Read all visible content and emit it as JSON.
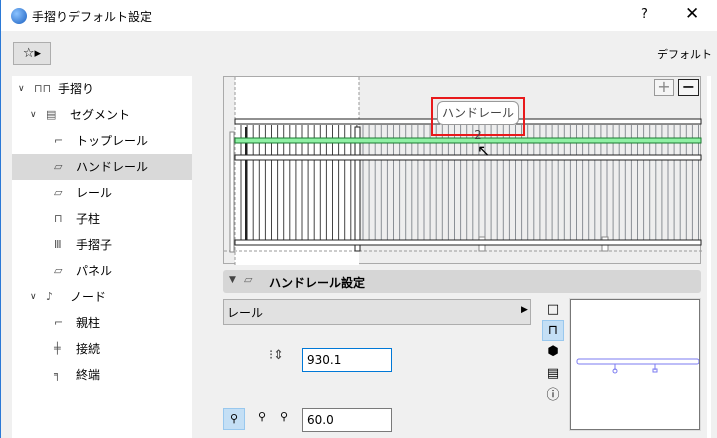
{
  "window": {
    "title": "手摺りデフォルト設定",
    "help": "?",
    "close": "✕"
  },
  "toolbar": {
    "favorites_icon": "☆▸",
    "default_label": "デフォルト"
  },
  "tree": [
    {
      "label": "手摺り",
      "level": 0,
      "expanded": true,
      "icon": "railing-icon"
    },
    {
      "label": "セグメント",
      "level": 1,
      "expanded": true,
      "icon": "segment-icon"
    },
    {
      "label": "トップレール",
      "level": 2,
      "icon": "top-rail-icon"
    },
    {
      "label": "ハンドレール",
      "level": 2,
      "icon": "handrail-icon",
      "selected": true
    },
    {
      "label": "レール",
      "level": 2,
      "icon": "rail-icon"
    },
    {
      "label": "子柱",
      "level": 2,
      "icon": "inner-post-icon"
    },
    {
      "label": "手摺子",
      "level": 2,
      "icon": "baluster-icon"
    },
    {
      "label": "パネル",
      "level": 2,
      "icon": "panel-icon"
    },
    {
      "label": "ノード",
      "level": 1,
      "expanded": true,
      "icon": "node-icon"
    },
    {
      "label": "親柱",
      "level": 2,
      "icon": "post-icon"
    },
    {
      "label": "接続",
      "level": 2,
      "icon": "connection-icon"
    },
    {
      "label": "終端",
      "level": 2,
      "icon": "end-icon"
    }
  ],
  "preview": {
    "tooltip": "ハンドレール 2",
    "zoom_in": "+",
    "zoom_out": "−",
    "highlight_color": "#8ff0a4"
  },
  "section": {
    "title": "ハンドレール設定",
    "select_value": "レール",
    "height_value": "930.1",
    "offset_value": "60.0"
  }
}
